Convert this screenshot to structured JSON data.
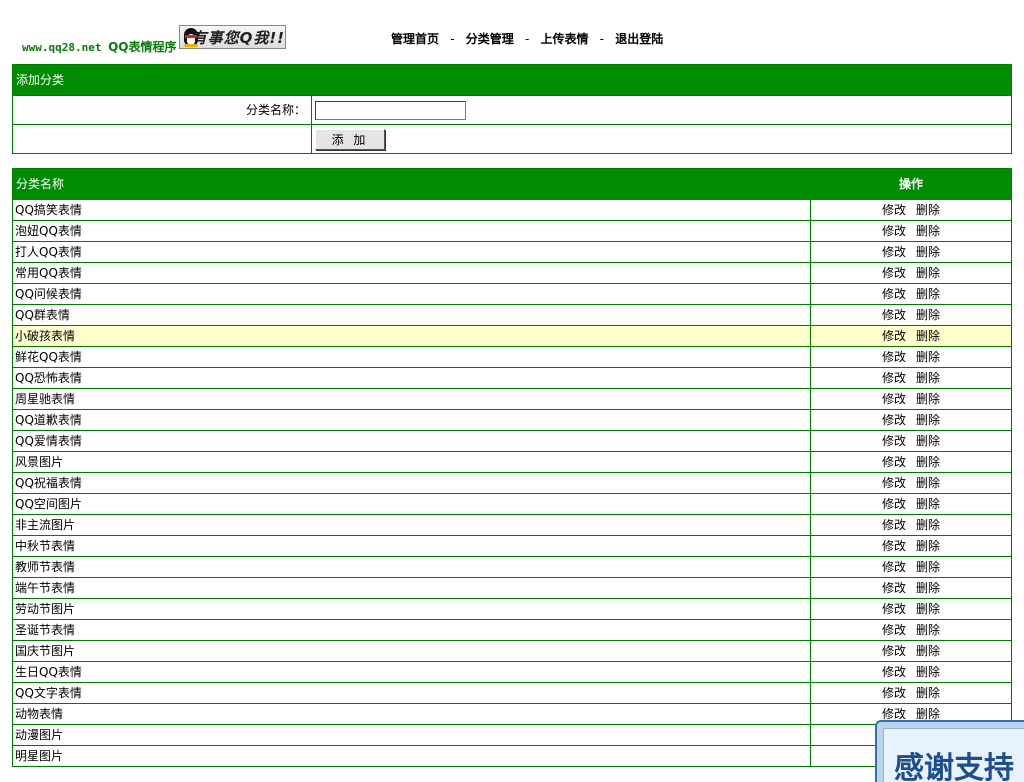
{
  "header": {
    "site_url": "www.qq28.net",
    "app_name": "QQ表情程序",
    "qq_badge_text": "有事您Q我!!"
  },
  "nav": {
    "home": "管理首页",
    "category": "分类管理",
    "upload": "上传表情",
    "logout": "退出登陆",
    "separator": "-"
  },
  "add_form": {
    "title": "添加分类",
    "name_label": "分类名称：",
    "name_value": "",
    "submit_label": "添 加"
  },
  "list": {
    "col_name": "分类名称",
    "col_ops": "操作",
    "edit_label": "修改",
    "delete_label": "删除",
    "highlighted_index": 6,
    "rows": [
      "QQ搞笑表情",
      "泡妞QQ表情",
      "打人QQ表情",
      "常用QQ表情",
      "QQ问候表情",
      "QQ群表情",
      "小破孩表情",
      "鲜花QQ表情",
      "QQ恐怖表情",
      "周星驰表情",
      "QQ道歉表情",
      "QQ爱情表情",
      "风景图片",
      "QQ祝福表情",
      "QQ空间图片",
      "非主流图片",
      "中秋节表情",
      "教师节表情",
      "端午节表情",
      "劳动节图片",
      "圣诞节表情",
      "国庆节图片",
      "生日QQ表情",
      "QQ文字表情",
      "动物表情",
      "动漫图片",
      "明星图片"
    ]
  },
  "float_banner": {
    "text": "感谢支持"
  },
  "colors": {
    "bar_green": "#008c00",
    "border_green": "#007a00",
    "highlight_row": "#ffffcc"
  }
}
